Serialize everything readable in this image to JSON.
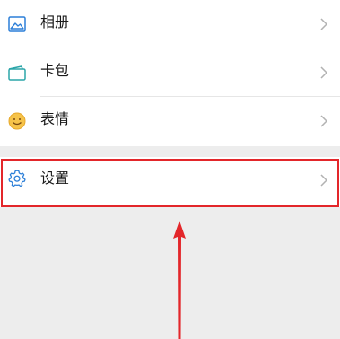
{
  "menu": {
    "items": [
      {
        "label": "相册",
        "icon": "photo-album-icon",
        "icon_color": "#2c7fd8"
      },
      {
        "label": "卡包",
        "icon": "card-wallet-icon",
        "icon_color": "#2ba5a9"
      },
      {
        "label": "表情",
        "icon": "emoji-smile-icon",
        "icon_color": "#f0b03c"
      }
    ],
    "settings": {
      "label": "设置",
      "icon": "gear-icon",
      "icon_color": "#2c7fd8"
    }
  },
  "annotation": {
    "highlight_color": "#e3262a",
    "arrow_color": "#e3262a"
  }
}
